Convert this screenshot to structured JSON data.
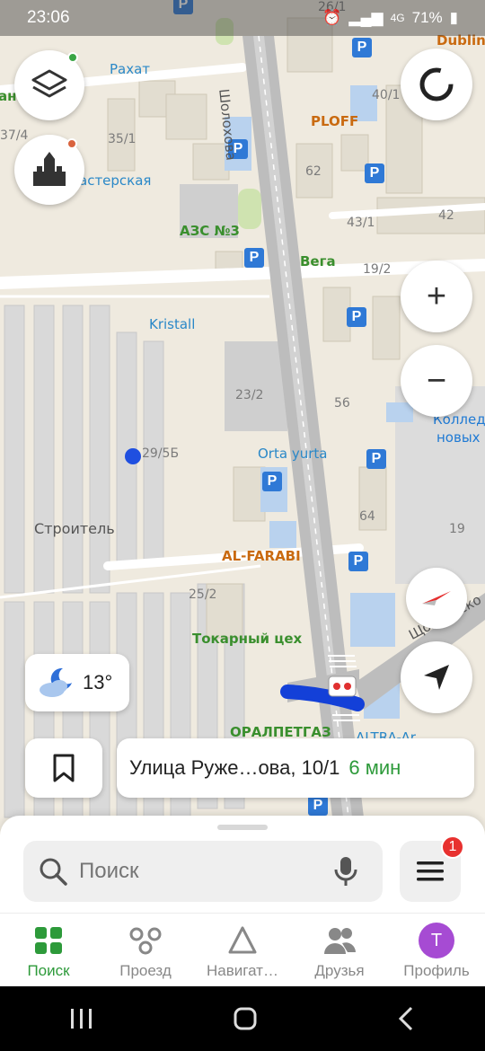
{
  "status_bar": {
    "time": "23:06",
    "battery": "71%",
    "network": "4G"
  },
  "map": {
    "street_labels": [
      {
        "text": "Шолохова"
      },
      {
        "text": "Щолковско"
      }
    ],
    "poi_labels": [
      {
        "text": "Рахат"
      },
      {
        "text": "PLOFF"
      },
      {
        "text": "астерская"
      },
      {
        "text": "АЗС №3"
      },
      {
        "text": "Вега"
      },
      {
        "text": "Kristall"
      },
      {
        "text": "Orta yurta"
      },
      {
        "text": "AL-FARABI"
      },
      {
        "text": "Токарный цех"
      },
      {
        "text": "ОРАЛПЕТГАЗ"
      },
      {
        "text": "ALTRA-Ar"
      },
      {
        "text": "Dublin"
      },
      {
        "text": "Колледж"
      },
      {
        "text": "новых"
      },
      {
        "text": "ан"
      }
    ],
    "building_numbers": [
      {
        "text": "26/1"
      },
      {
        "text": "40/1"
      },
      {
        "text": "37/4"
      },
      {
        "text": "35/1"
      },
      {
        "text": "62"
      },
      {
        "text": "43/1"
      },
      {
        "text": "42"
      },
      {
        "text": "19/2"
      },
      {
        "text": "23/2"
      },
      {
        "text": "56"
      },
      {
        "text": "29/5Б"
      },
      {
        "text": "64"
      },
      {
        "text": "19"
      },
      {
        "text": "25/2"
      }
    ],
    "district_label": "Строитель"
  },
  "controls": {
    "layers_icon": "layers-icon",
    "places_icon": "city-icon",
    "compass_icon": "rotate-icon",
    "zoom_in": "+",
    "zoom_out": "−",
    "locate_icon": "navigation-arrow-icon"
  },
  "weather": {
    "temperature": "13°",
    "icon": "moon-cloud-icon"
  },
  "route": {
    "destination": "Улица Руже…ова, 10/1",
    "eta": "6 мин"
  },
  "search": {
    "placeholder": "Поиск",
    "menu_badge": "1"
  },
  "tabs": [
    {
      "label": "Поиск",
      "active": true
    },
    {
      "label": "Проезд",
      "active": false
    },
    {
      "label": "Навигат…",
      "active": false
    },
    {
      "label": "Друзья",
      "active": false
    },
    {
      "label": "Профиль",
      "active": false,
      "avatar_letter": "Т"
    }
  ],
  "colors": {
    "accent": "#2d9a3a",
    "parking": "#2f79d6",
    "avatar": "#a64bd3",
    "badge": "#e8312f"
  }
}
